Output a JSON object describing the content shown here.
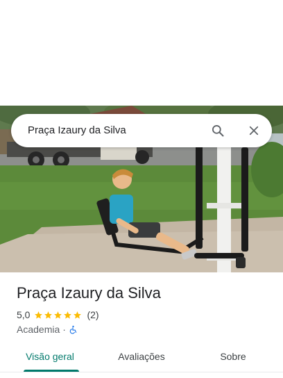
{
  "search": {
    "query": "Praça Izaury da Silva",
    "search_icon": "search-icon",
    "close_icon": "close-icon"
  },
  "place": {
    "name": "Praça Izaury da Silva",
    "rating": "5,0",
    "stars": 5,
    "review_count": "(2)",
    "category": "Academia",
    "separator": "·",
    "accessibility_icon": "wheelchair-icon"
  },
  "tabs": [
    {
      "label": "Visão geral",
      "active": true
    },
    {
      "label": "Avaliações",
      "active": false
    },
    {
      "label": "Sobre",
      "active": false
    }
  ],
  "colors": {
    "accent": "#00796b",
    "star": "#fbbc04",
    "accessibility": "#1a73e8"
  }
}
